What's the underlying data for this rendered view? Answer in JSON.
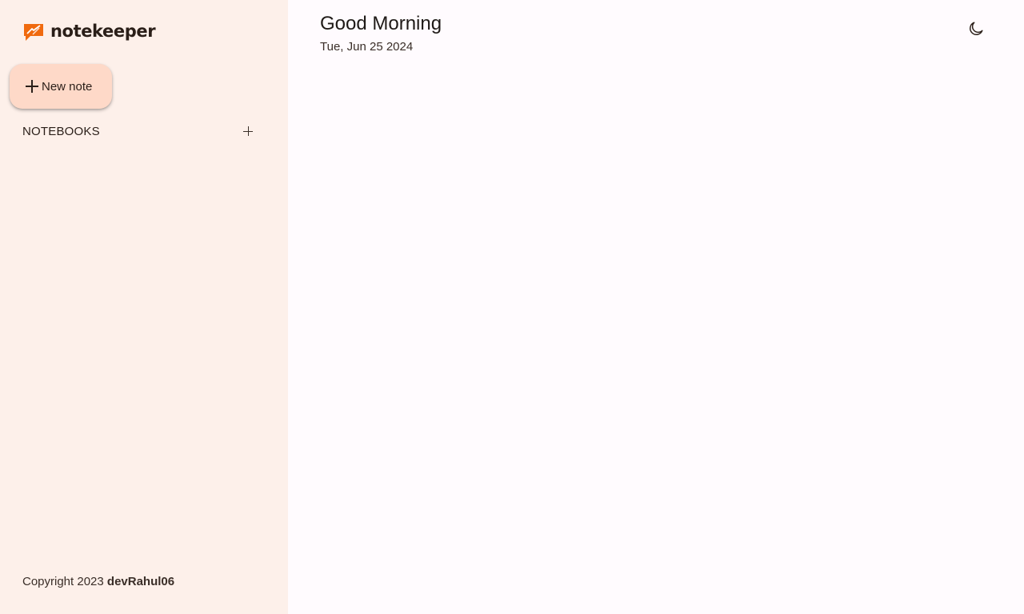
{
  "sidebar": {
    "logo": {
      "text": "notekeeper",
      "icon": "notekeeper-logo-icon",
      "accent_color": "#f06a0f"
    },
    "new_note_button": {
      "icon": "plus-icon",
      "label": "New note"
    },
    "notebooks": {
      "label": "NOTEBOOKS",
      "add_icon": "plus-icon",
      "items": []
    },
    "footer": {
      "text": "Copyright 2023",
      "author": "devRahul06"
    }
  },
  "main": {
    "greeting": "Good Morning",
    "date": "Tue, Jun 25 2024",
    "theme_toggle": {
      "icon": "moon-icon"
    }
  },
  "colors": {
    "sidebar_bg": "#fdf0ea",
    "main_bg": "#fffbfe",
    "button_bg": "#fed9c8",
    "brand": "#f06a0f"
  }
}
